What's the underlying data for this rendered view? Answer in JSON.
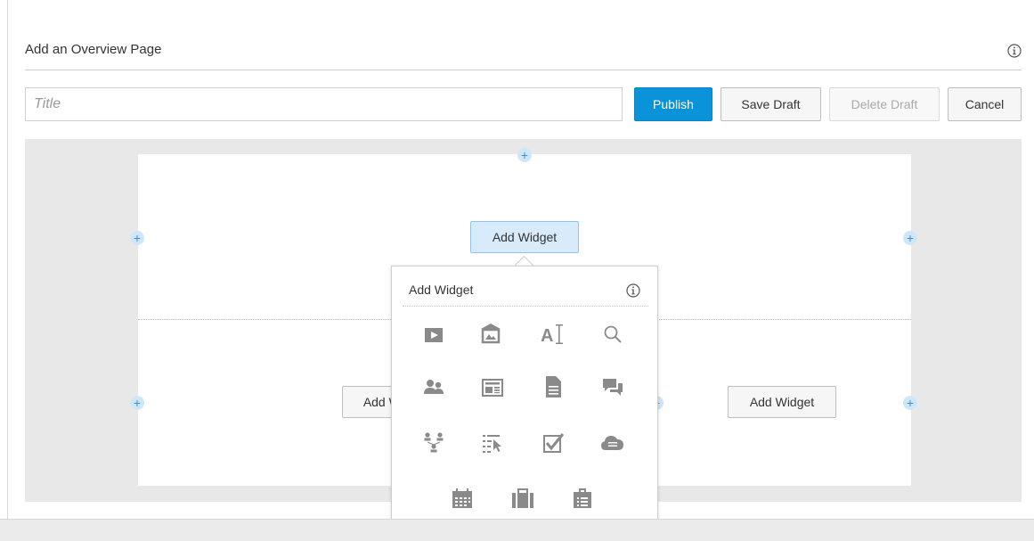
{
  "header": {
    "title": "Add an Overview Page",
    "info_icon": "info-circle-icon"
  },
  "form": {
    "title_placeholder": "Title",
    "title_value": "",
    "publish_label": "Publish",
    "save_draft_label": "Save Draft",
    "delete_draft_label": "Delete Draft",
    "cancel_label": "Cancel"
  },
  "layout": {
    "add_plus_symbol": "+",
    "add_widget_label": "Add Widget"
  },
  "popup": {
    "title": "Add Widget",
    "info_icon": "info-circle-icon",
    "icons": [
      "video-icon",
      "image-gallery-icon",
      "text-icon",
      "search-icon",
      "people-icon",
      "news-icon",
      "document-icon",
      "discussion-icon",
      "org-chart-icon",
      "task-list-icon",
      "checkbox-icon",
      "cloud-icon",
      "calendar-icon",
      "briefcase-icon",
      "clipboard-icon"
    ]
  },
  "colors": {
    "primary": "#0b93d9",
    "canvas_bg": "#e8e8e8",
    "icon_gray": "#8a8a8a",
    "plus_bg": "#cfe6f9"
  }
}
